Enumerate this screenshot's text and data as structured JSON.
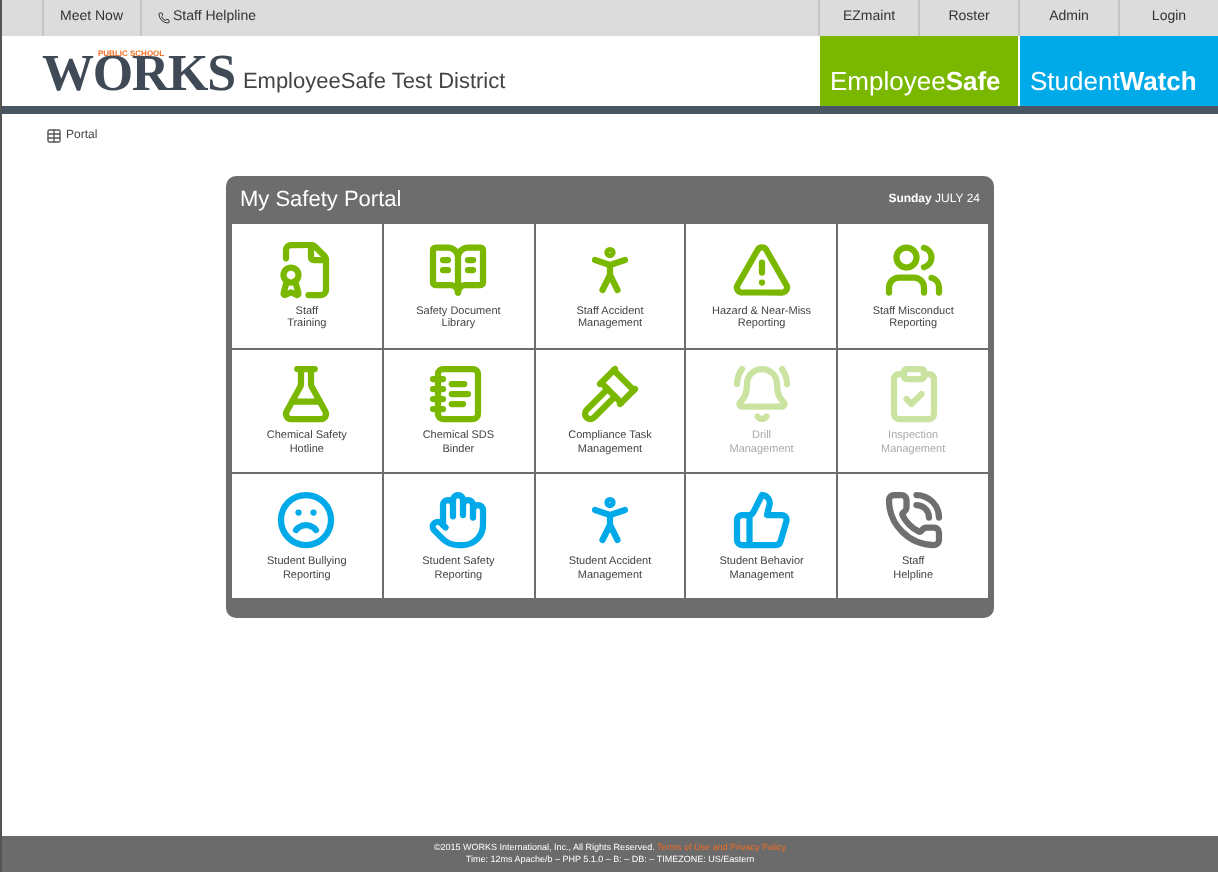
{
  "top_bar": {
    "left": [
      {
        "label": "Meet Now",
        "kind": "plain"
      },
      {
        "label": "Staff Helpline",
        "kind": "phone"
      }
    ],
    "right": [
      "EZmaint",
      "Roster",
      "Admin",
      "Login"
    ]
  },
  "header": {
    "logo_small": "PUBLIC SCHOOL",
    "logo_big": "WORKS",
    "district": "EmployeeSafe Test District",
    "products": [
      {
        "light": "Employee",
        "bold": "Safe",
        "color": "#7ab800"
      },
      {
        "light": "Student",
        "bold": "Watch",
        "color": "#00a9e8"
      }
    ]
  },
  "breadcrumb": "Portal",
  "portal": {
    "title": "My Safety Portal",
    "day": "Sunday",
    "date": "JULY 24",
    "tiles": [
      {
        "label": "Staff\nTraining",
        "color": "#7ab800",
        "disabled": false
      },
      {
        "label": "Safety Document\nLibrary",
        "color": "#7ab800",
        "disabled": false
      },
      {
        "label": "Staff Accident\nManagement",
        "color": "#7ab800",
        "disabled": false
      },
      {
        "label": "Hazard & Near-Miss\nReporting",
        "color": "#7ab800",
        "disabled": false
      },
      {
        "label": "Staff Misconduct\nReporting",
        "color": "#7ab800",
        "disabled": false
      },
      {
        "label": "Chemical Safety\nHotline",
        "color": "#7ab800",
        "disabled": false
      },
      {
        "label": "Chemical SDS\nBinder",
        "color": "#7ab800",
        "disabled": false
      },
      {
        "label": "Compliance Task\nManagement",
        "color": "#7ab800",
        "disabled": false
      },
      {
        "label": "Drill\nManagement",
        "color": "#cae3a0",
        "disabled": true
      },
      {
        "label": "Inspection\nManagement",
        "color": "#cae3a0",
        "disabled": true
      },
      {
        "label": "Student Bullying\nReporting",
        "color": "#00a9e8",
        "disabled": false
      },
      {
        "label": "Student Safety\nReporting",
        "color": "#00a9e8",
        "disabled": false
      },
      {
        "label": "Student Accident\nManagement",
        "color": "#00a9e8",
        "disabled": false
      },
      {
        "label": "Student Behavior\nManagement",
        "color": "#00a9e8",
        "disabled": false
      },
      {
        "label": "Staff\nHelpline",
        "color": "#6f6f6f",
        "disabled": false
      }
    ]
  },
  "footer": {
    "copyright": "©2015 WORKS International, Inc., All Rights Reserved.",
    "link": "Terms of Use and Privacy Policy",
    "info": "Time: 12ms Apache/b – PHP 5.1.0 – B: – DB: – TIMEZONE: US/Eastern"
  }
}
